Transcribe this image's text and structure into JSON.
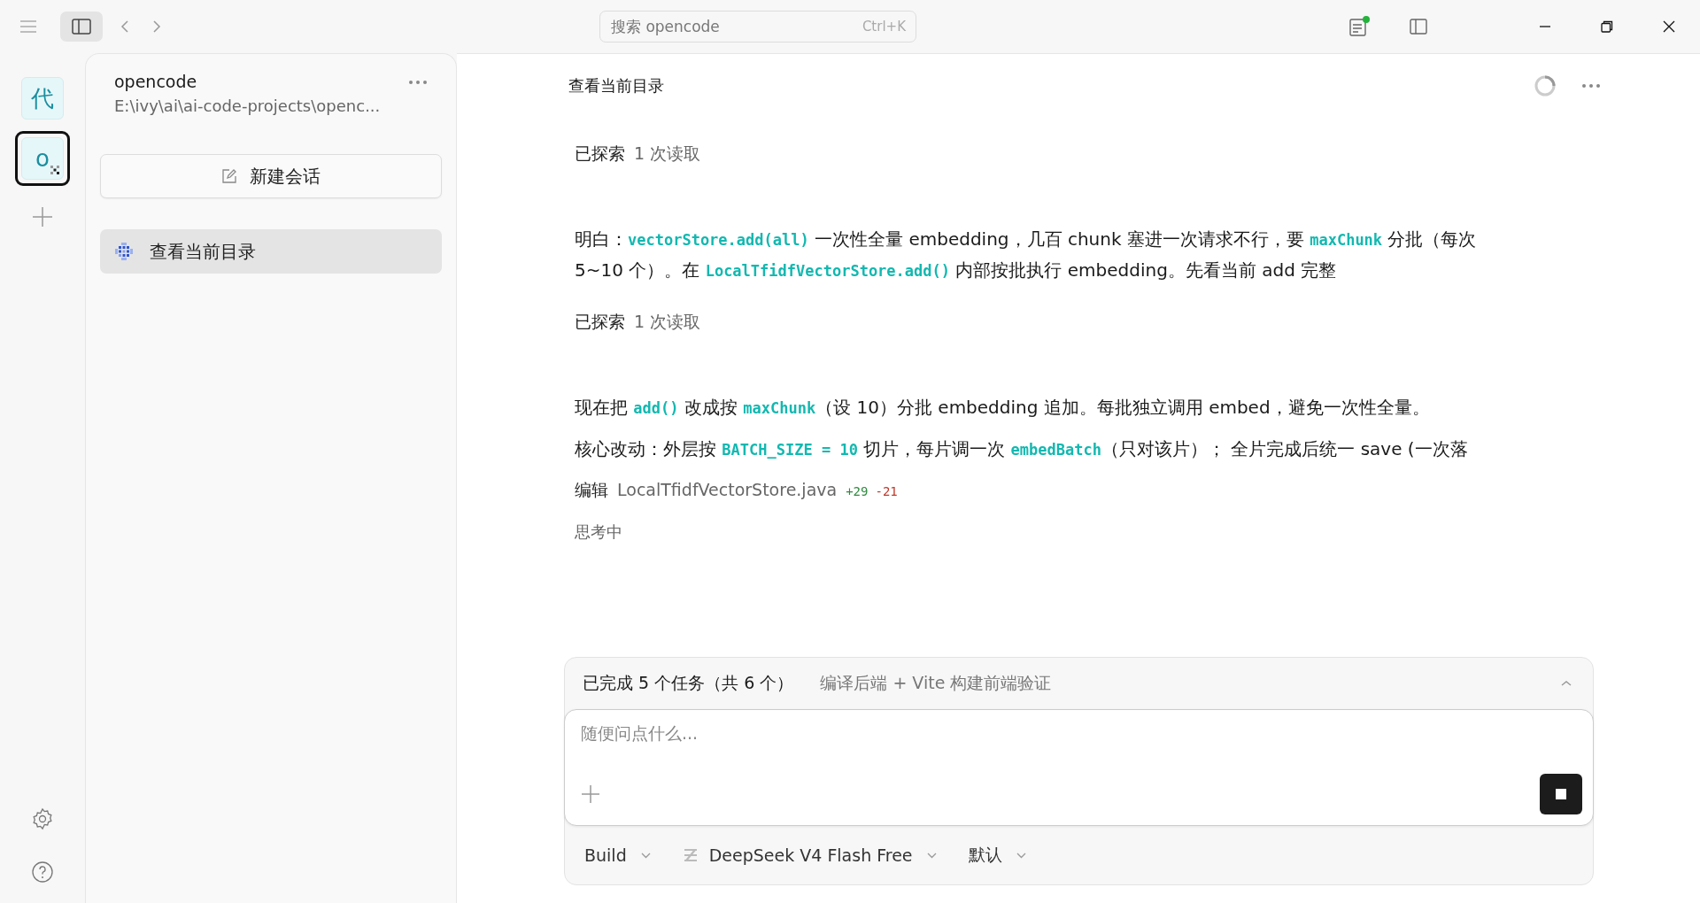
{
  "titlebar": {
    "search_placeholder": "搜索 opencode",
    "search_shortcut": "Ctrl+K",
    "notification": true
  },
  "rail": {
    "workspaces": [
      {
        "label": "代",
        "selected": false,
        "busy": false
      },
      {
        "label": "o",
        "selected": true,
        "busy": true
      }
    ]
  },
  "sidebar": {
    "project": "opencode",
    "path": "E:\\ivy\\ai\\ai-code-projects\\openc...",
    "new_session": "新建会话",
    "sessions": [
      {
        "title": "查看当前目录",
        "selected": true,
        "busy": true
      }
    ]
  },
  "session": {
    "title": "查看当前目录",
    "busy": true,
    "messages": [
      {
        "kind": "tool",
        "verb": "已探索",
        "detail": "1 次读取"
      },
      {
        "kind": "text",
        "segments": [
          {
            "kind": "text",
            "text": "明白："
          },
          {
            "kind": "code",
            "text": "vectorStore.add(all)"
          },
          {
            "kind": "text",
            "text": " 一次性全量 embedding，几百 chunk 塞进一次请求不行，要 "
          },
          {
            "kind": "code",
            "text": "maxChunk"
          },
          {
            "kind": "text",
            "text": " 分批（每次 5~10 个）。在 "
          },
          {
            "kind": "code",
            "text": "LocalTfidfVectorStore.add()"
          },
          {
            "kind": "text",
            "text": " 内部按批执行 embedding。先看当前 add 完整"
          }
        ]
      },
      {
        "kind": "tool",
        "verb": "已探索",
        "detail": "1 次读取"
      },
      {
        "kind": "text",
        "segments": [
          {
            "kind": "text",
            "text": "现在把 "
          },
          {
            "kind": "code",
            "text": "add()"
          },
          {
            "kind": "text",
            "text": " 改成按 "
          },
          {
            "kind": "code",
            "text": "maxChunk"
          },
          {
            "kind": "text",
            "text": "（设 10）分批 embedding 追加。每批独立调用 embed，避免一次性全量。"
          }
        ]
      },
      {
        "kind": "text",
        "segments": [
          {
            "kind": "text",
            "text": "核心改动：外层按 "
          },
          {
            "kind": "code",
            "text": "BATCH_SIZE = 10"
          },
          {
            "kind": "text",
            "text": " 切片，每片调一次 "
          },
          {
            "kind": "code",
            "text": "embedBatch"
          },
          {
            "kind": "text",
            "text": "（只对该片）； 全片完成后统一 save (一次落"
          }
        ]
      },
      {
        "kind": "edit",
        "verb": "编辑",
        "file": "LocalTfidfVectorStore.java",
        "added": "+29",
        "removed": "-21"
      },
      {
        "kind": "status",
        "text": "思考中"
      }
    ]
  },
  "composer": {
    "todo_summary": "已完成 5 个任务（共 6 个）",
    "todo_current": "编译后端 + Vite 构建前端验证",
    "todo_expanded": false,
    "placeholder": "随便问点什么...",
    "agent": "Build",
    "model": "DeepSeek V4 Flash Free",
    "variant": "默认"
  }
}
